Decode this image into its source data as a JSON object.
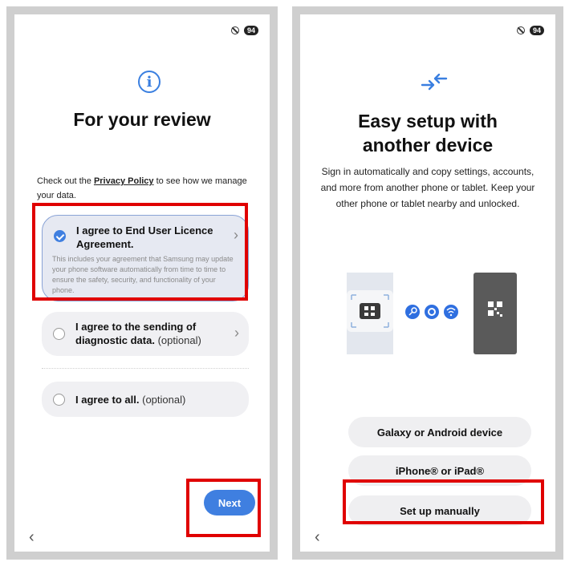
{
  "status": {
    "battery": "94"
  },
  "left": {
    "title": "For your review",
    "intro": {
      "before": "Check out the ",
      "link": "Privacy Policy",
      "after": " to see how we manage your data."
    },
    "options": [
      {
        "title": "I agree to End User Licence Agreement.",
        "optional": "",
        "checked": true,
        "description": "This includes your agreement that Samsung may update your phone software automatically from time to time to ensure the safety, security, and functionality of your phone."
      },
      {
        "title": "I agree to the sending of diagnostic data.",
        "optional": "(optional)",
        "checked": false,
        "description": ""
      },
      {
        "title": "I agree to all.",
        "optional": "(optional)",
        "checked": false,
        "description": ""
      }
    ],
    "next_label": "Next"
  },
  "right": {
    "title": "Easy setup with another device",
    "description": "Sign in automatically and copy settings, accounts, and more from another phone or tablet. Keep your other phone or tablet nearby and unlocked.",
    "buttons": [
      "Galaxy or Android device",
      "iPhone® or iPad®",
      "Set up manually"
    ]
  },
  "colors": {
    "accent": "#3f7fe0",
    "highlight": "#e00000"
  },
  "icons": [
    "info-icon",
    "transfer-arrows-icon",
    "checkmark-icon",
    "chevron-right-icon",
    "back-icon",
    "do-not-disturb-icon",
    "key-icon",
    "gear-icon",
    "wifi-icon",
    "qr-code-icon"
  ]
}
